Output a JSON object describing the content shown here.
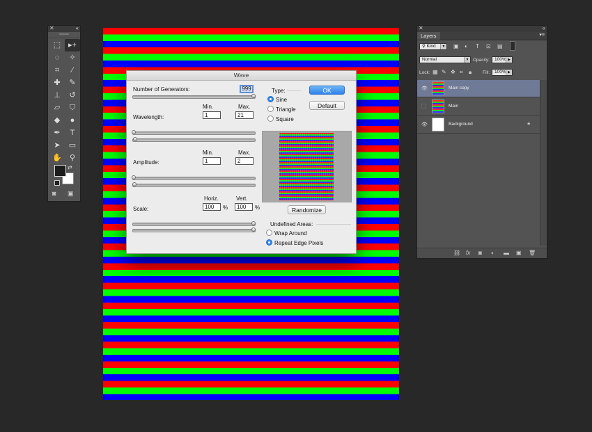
{
  "tools_panel": {
    "close_glyph": "✕",
    "collapse_glyph": "«",
    "tools": [
      {
        "icon": "rect-marquee-icon",
        "glyph": "⬚"
      },
      {
        "icon": "move-tool-icon",
        "glyph": "▸+"
      },
      {
        "icon": "lasso-icon",
        "glyph": "◌"
      },
      {
        "icon": "magic-wand-icon",
        "glyph": "✧"
      },
      {
        "icon": "crop-icon",
        "glyph": "⌗"
      },
      {
        "icon": "eyedropper-icon",
        "glyph": "⁄"
      },
      {
        "icon": "healing-brush-icon",
        "glyph": "✚"
      },
      {
        "icon": "brush-icon",
        "glyph": "✎"
      },
      {
        "icon": "clone-stamp-icon",
        "glyph": "⊥"
      },
      {
        "icon": "history-brush-icon",
        "glyph": "↺"
      },
      {
        "icon": "eraser-icon",
        "glyph": "▱"
      },
      {
        "icon": "paint-bucket-icon",
        "glyph": "⛉"
      },
      {
        "icon": "blur-icon",
        "glyph": "◆"
      },
      {
        "icon": "dodge-icon",
        "glyph": "●"
      },
      {
        "icon": "pen-icon",
        "glyph": "✒"
      },
      {
        "icon": "type-icon",
        "glyph": "T"
      },
      {
        "icon": "path-select-icon",
        "glyph": "➤"
      },
      {
        "icon": "rectangle-shape-icon",
        "glyph": "▭"
      },
      {
        "icon": "hand-icon",
        "glyph": "✋"
      },
      {
        "icon": "zoom-icon",
        "glyph": "⚲"
      }
    ],
    "selected_tool": "move-tool-icon",
    "foreground_color": "#1c1c1c",
    "background_color": "#ffffff",
    "swap_glyph": "⇄",
    "quick_mask_glyph": "◙",
    "screen_mode_glyph": "▣"
  },
  "dialog": {
    "title": "Wave",
    "num_generators_label": "Number of Generators:",
    "num_generators_value": "999",
    "wavelength_label": "Wavelength:",
    "amplitude_label": "Amplitude:",
    "scale_label": "Scale:",
    "min_label": "Min.",
    "max_label": "Max.",
    "wavelength_min": "1",
    "wavelength_max": "21",
    "amplitude_min": "1",
    "amplitude_max": "2",
    "horiz_label": "Horiz.",
    "vert_label": "Vert.",
    "scale_horiz": "100",
    "scale_vert": "100",
    "percent": "%",
    "type_label": "Type:",
    "type_options": [
      "Sine",
      "Triangle",
      "Square"
    ],
    "type_selected": "Sine",
    "ok_label": "OK",
    "default_label": "Default",
    "randomize_label": "Randomize",
    "undefined_areas_label": "Undefined Areas:",
    "undefined_options": [
      "Wrap Around",
      "Repeat Edge Pixels"
    ],
    "undefined_selected": "Repeat Edge Pixels",
    "accent_color": "#2e86ee"
  },
  "layers_panel": {
    "tab_title": "Layers",
    "close_glyph": "✕",
    "collapse_glyph": "«",
    "menu_glyph": "▾≡",
    "filter_kind": "Kind",
    "blend_mode": "Normal",
    "opacity_label": "Opacity:",
    "opacity_value": "100%",
    "lock_label": "Lock:",
    "fill_label": "Fill:",
    "fill_value": "100%",
    "layers": [
      {
        "name": "Main copy",
        "visible": true,
        "selected": true,
        "thumb": "stripes",
        "locked": false
      },
      {
        "name": "Main",
        "visible": false,
        "selected": false,
        "thumb": "stripes",
        "locked": false
      },
      {
        "name": "Background",
        "visible": true,
        "selected": false,
        "thumb": "white",
        "locked": true
      }
    ],
    "footer_icons": [
      "link-icon",
      "fx-icon",
      "mask-icon",
      "adjustment-icon",
      "group-folder-icon",
      "new-layer-icon",
      "trash-icon"
    ]
  },
  "canvas": {
    "stripe_colors": [
      "#ff0000",
      "#00ff00",
      "#0000ff"
    ]
  }
}
